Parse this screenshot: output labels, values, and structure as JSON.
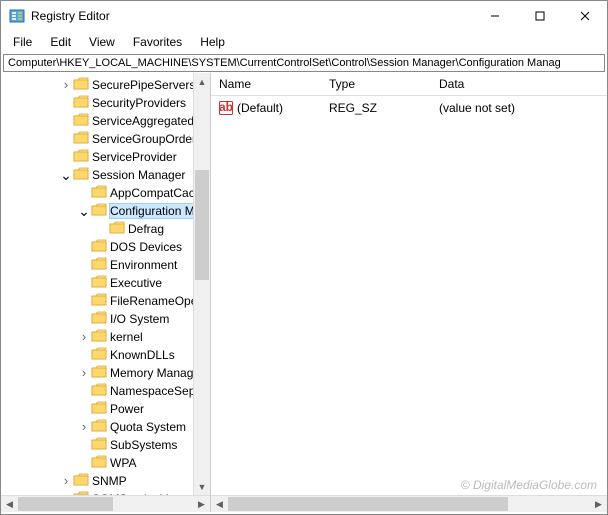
{
  "window": {
    "title": "Registry Editor"
  },
  "menu": {
    "file": "File",
    "edit": "Edit",
    "view": "View",
    "favorites": "Favorites",
    "help": "Help"
  },
  "address": "Computer\\HKEY_LOCAL_MACHINE\\SYSTEM\\CurrentControlSet\\Control\\Session Manager\\Configuration Manag",
  "tree": {
    "items": [
      {
        "indent": 58,
        "chev": ">",
        "label": "SecurePipeServers"
      },
      {
        "indent": 58,
        "chev": "",
        "label": "SecurityProviders"
      },
      {
        "indent": 58,
        "chev": "",
        "label": "ServiceAggregatedE"
      },
      {
        "indent": 58,
        "chev": "",
        "label": "ServiceGroupOrder"
      },
      {
        "indent": 58,
        "chev": "",
        "label": "ServiceProvider"
      },
      {
        "indent": 58,
        "chev": "v",
        "label": "Session Manager"
      },
      {
        "indent": 76,
        "chev": "",
        "label": "AppCompatCacl"
      },
      {
        "indent": 76,
        "chev": "v",
        "label": "Configuration M",
        "selected": true
      },
      {
        "indent": 94,
        "chev": "",
        "label": "Defrag"
      },
      {
        "indent": 76,
        "chev": "",
        "label": "DOS Devices"
      },
      {
        "indent": 76,
        "chev": "",
        "label": "Environment"
      },
      {
        "indent": 76,
        "chev": "",
        "label": "Executive"
      },
      {
        "indent": 76,
        "chev": "",
        "label": "FileRenameOper"
      },
      {
        "indent": 76,
        "chev": "",
        "label": "I/O System"
      },
      {
        "indent": 76,
        "chev": ">",
        "label": "kernel"
      },
      {
        "indent": 76,
        "chev": "",
        "label": "KnownDLLs"
      },
      {
        "indent": 76,
        "chev": ">",
        "label": "Memory Manage"
      },
      {
        "indent": 76,
        "chev": "",
        "label": "NamespaceSepa"
      },
      {
        "indent": 76,
        "chev": "",
        "label": "Power"
      },
      {
        "indent": 76,
        "chev": ">",
        "label": "Quota System"
      },
      {
        "indent": 76,
        "chev": "",
        "label": "SubSystems"
      },
      {
        "indent": 76,
        "chev": "",
        "label": "WPA"
      },
      {
        "indent": 58,
        "chev": ">",
        "label": "SNMP"
      },
      {
        "indent": 58,
        "chev": "",
        "label": "SOMServiceList"
      }
    ]
  },
  "list": {
    "headers": {
      "name": "Name",
      "type": "Type",
      "data": "Data"
    },
    "rows": [
      {
        "name": "(Default)",
        "type": "REG_SZ",
        "data": "(value not set)"
      }
    ]
  },
  "watermark": "© DigitalMediaGlobe.com"
}
